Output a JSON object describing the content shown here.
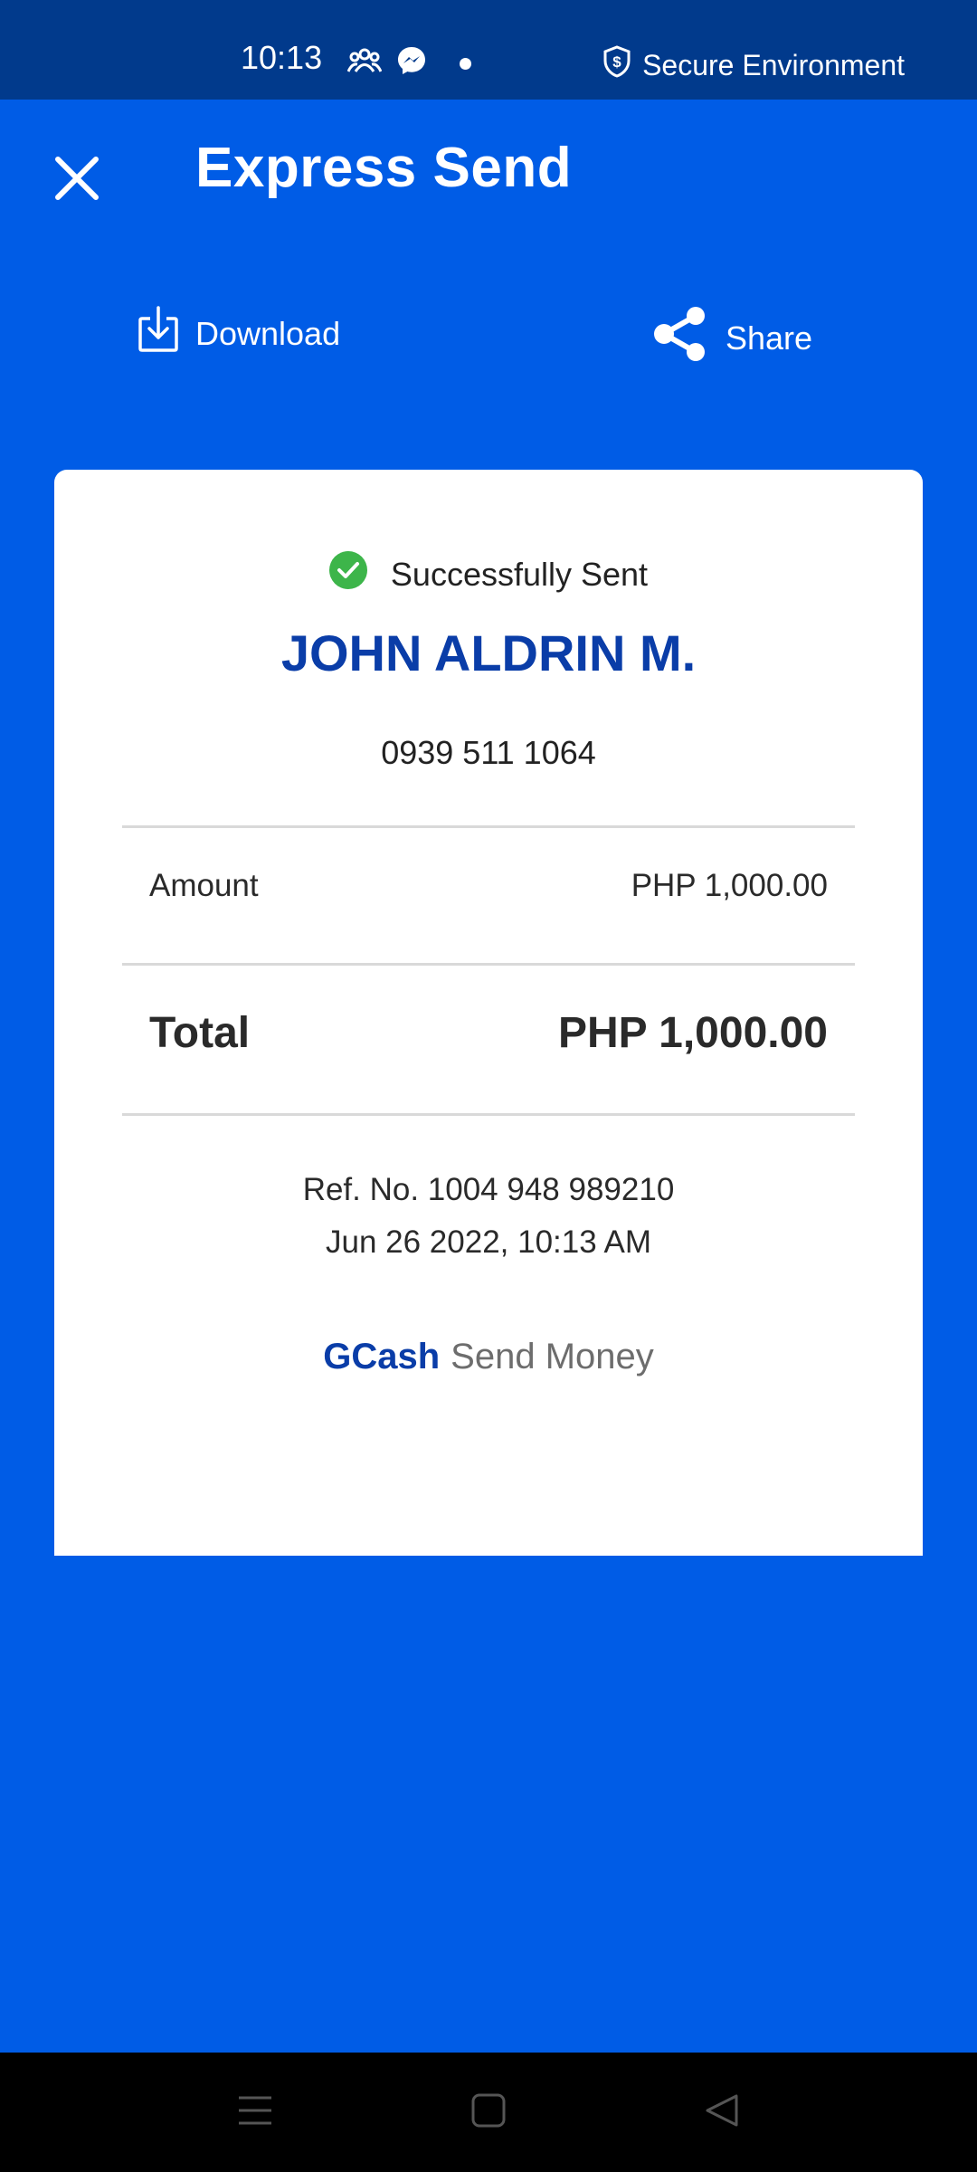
{
  "status_bar": {
    "time": "10:13",
    "secure_label": "Secure Environment"
  },
  "header": {
    "title": "Express Send"
  },
  "actions": {
    "download_label": "Download",
    "share_label": "Share"
  },
  "receipt": {
    "status_text": "Successfully Sent",
    "recipient_name": "JOHN ALDRIN M.",
    "recipient_number": "0939 511 1064",
    "amount_label": "Amount",
    "amount_value": "PHP 1,000.00",
    "total_label": "Total",
    "total_value": "PHP 1,000.00",
    "reference": "Ref. No. 1004 948 989210",
    "datetime": "Jun 26 2022, 10:13 AM",
    "brand_name": "GCash",
    "brand_service": "Send Money"
  },
  "colors": {
    "background": "#005CE6",
    "status_bar": "#013A8C",
    "accent_text": "#0A3DA8",
    "success": "#3DB54A"
  },
  "icons": [
    "close-icon",
    "download-icon",
    "share-icon",
    "check-circle-icon",
    "group-icon",
    "messenger-icon",
    "shield-icon",
    "menu-icon",
    "home-icon",
    "back-icon"
  ]
}
